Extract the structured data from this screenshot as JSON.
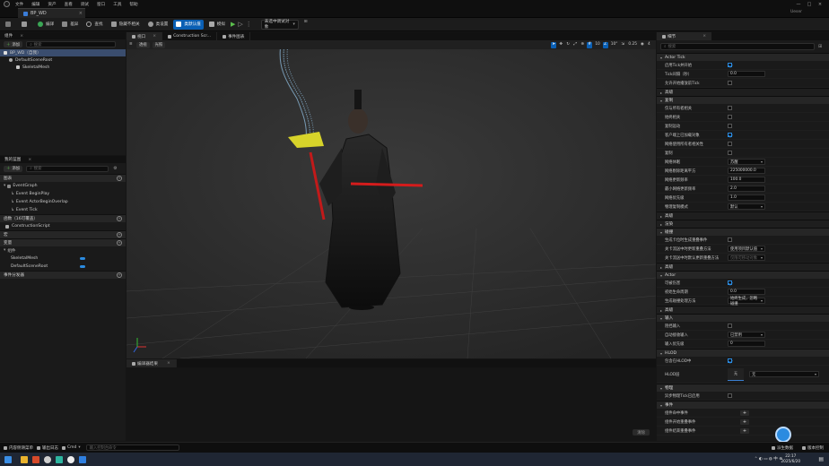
{
  "menu": {
    "items": [
      "文件",
      "编辑",
      "资产",
      "查看",
      "调试",
      "窗口",
      "工具",
      "帮助"
    ]
  },
  "document_tab": {
    "label": "BP_WD",
    "close": "×"
  },
  "project_label": "Ueser",
  "window_controls": [
    "—",
    "□",
    "×"
  ],
  "toolbar": {
    "compile": "编译",
    "diff": "差异",
    "find": "查找",
    "hide_unrelated": "隐藏不相关",
    "class_settings": "类设置",
    "class_defaults": "类默认值",
    "simulation": "模拟",
    "debug_object": "未选中调试对象"
  },
  "components": {
    "tab": "组件",
    "add": "添加",
    "search_placeholder": "搜索",
    "items": [
      {
        "label": "BP_WD（自我）",
        "selected": true
      },
      {
        "label": "DefaultSceneRoot",
        "selected": false
      },
      {
        "label": "SkeletalMesh",
        "selected": false
      }
    ]
  },
  "my_blueprint": {
    "tab": "我的蓝图",
    "add": "添加",
    "search_placeholder": "搜索",
    "sections": {
      "graphs": "图表",
      "functions": "函数（16可覆盖）",
      "macros": "宏",
      "variables": "变量",
      "components": "组件",
      "event_dispatchers": "事件分发器"
    },
    "event_graph": "EventGraph",
    "events": [
      "Event BeginPlay",
      "Event ActorBeginOverlap",
      "Event Tick"
    ],
    "functions": [
      "ConstructionScript"
    ],
    "component_vars": [
      "SkeletalMesh",
      "DefaultSceneRoot"
    ]
  },
  "viewport": {
    "tabs": [
      "视口",
      "Construction Scr...",
      "事件图表"
    ],
    "close": "×",
    "mode_perspective": "透视",
    "mode_lit": "光照",
    "snap_grid": "10",
    "snap_angle": "10°",
    "snap_scale": "0.25",
    "camera_speed": "4"
  },
  "compiler_results": {
    "tab": "编译器结果",
    "clear": "清除"
  },
  "details": {
    "tab": "细节",
    "search_placeholder": "搜索",
    "sections": [
      {
        "name": "Actor Tick",
        "props": [
          {
            "label": "启用Tick并开始",
            "type": "check",
            "value": true
          },
          {
            "label": "Tick间隔（秒）",
            "type": "num",
            "value": "0.0"
          },
          {
            "label": "允许开始播放前Tick",
            "type": "check",
            "value": false
          }
        ]
      },
      {
        "name": "高级",
        "collapsed": true
      },
      {
        "name": "复制",
        "props": [
          {
            "label": "仅与所有者相关",
            "type": "check",
            "value": false
          },
          {
            "label": "始终相关",
            "type": "check",
            "value": false
          },
          {
            "label": "复制运动",
            "type": "check",
            "value": false
          },
          {
            "label": "客户端上已加载对象",
            "type": "check",
            "value": true
          },
          {
            "label": "网络使用所有者相关性",
            "type": "check",
            "value": false
          },
          {
            "label": "复制",
            "type": "check",
            "value": false
          },
          {
            "label": "网络休眠",
            "type": "drop",
            "value": "苏醒"
          },
          {
            "label": "网络剔除距离平方",
            "type": "num",
            "value": "225000000.0"
          },
          {
            "label": "网络更新频率",
            "type": "num",
            "value": "100.0"
          },
          {
            "label": "最小网络更新频率",
            "type": "num",
            "value": "2.0"
          },
          {
            "label": "网络优先级",
            "type": "num",
            "value": "1.0"
          },
          {
            "label": "物理复制模式",
            "type": "drop",
            "value": "默认"
          }
        ]
      },
      {
        "name": "高级",
        "collapsed": true
      },
      {
        "name": "渲染",
        "collapsed": true
      },
      {
        "name": "碰撞",
        "props": [
          {
            "label": "生成卡位时生成重叠事件",
            "type": "check",
            "value": false
          },
          {
            "label": "关卡流送中时更新重叠方法",
            "type": "drop",
            "value": "使用项目默认值"
          },
          {
            "label": "关卡流送中时默认更新重叠方法",
            "type": "drop",
            "value": "仅限可移动对象",
            "disabled": true
          }
        ]
      },
      {
        "name": "高级",
        "collapsed": true
      },
      {
        "name": "Actor",
        "props": [
          {
            "label": "可被伤害",
            "type": "check",
            "value": true
          },
          {
            "label": "初始生命周期",
            "type": "num",
            "value": "0.0"
          },
          {
            "label": "生成碰撞处理方法",
            "type": "drop",
            "value": "始终生成，忽略碰撞"
          }
        ]
      },
      {
        "name": "高级",
        "collapsed": true
      },
      {
        "name": "输入",
        "props": [
          {
            "label": "阻挡输入",
            "type": "check",
            "value": false
          },
          {
            "label": "自动接收输入",
            "type": "drop",
            "value": "已禁用"
          },
          {
            "label": "输入优先级",
            "type": "num",
            "value": "0"
          }
        ]
      },
      {
        "name": "HLOD",
        "props": [
          {
            "label": "包含在HLOD中",
            "type": "check",
            "value": true
          },
          {
            "label": "HLOD层",
            "type": "hlod",
            "value": "无"
          }
        ]
      },
      {
        "name": "物理",
        "props": [
          {
            "label": "异步物理Tick已启用",
            "type": "check",
            "value": false
          }
        ]
      },
      {
        "name": "事件",
        "props": [
          {
            "label": "组件命中事件",
            "type": "plus"
          },
          {
            "label": "组件开始重叠事件",
            "type": "plus"
          },
          {
            "label": "组件结束重叠事件",
            "type": "plus"
          }
        ]
      }
    ]
  },
  "statusbar": {
    "content_drawer": "内容侧滑菜单",
    "output_log": "输出日志",
    "cmd": "Cmd",
    "console_placeholder": "输入控制台命令",
    "derived_data": "派生数据",
    "source_control": "版本控制"
  },
  "taskbar": {
    "time": "22:17",
    "date": "2025/6/20"
  }
}
